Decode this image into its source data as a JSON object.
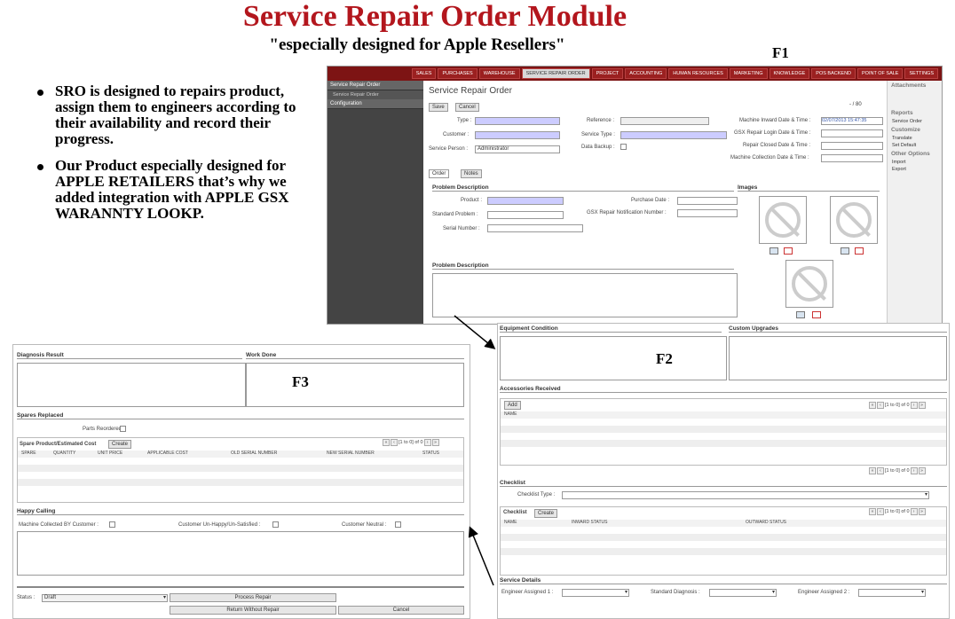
{
  "header": {
    "title": "Service Repair Order Module",
    "subtitle": "\"especially designed for Apple Resellers\"",
    "f1": "F1",
    "f2": "F2",
    "f3": "F3"
  },
  "bullets": [
    "SRO is designed to repairs product, assign them to engineers according to their availability and record their progress.",
    "Our Product especially designed for APPLE RETAILERS that’s why we added integration with APPLE GSX WARANNTY LOOKP."
  ],
  "topnav": [
    "SALES",
    "PURCHASES",
    "WAREHOUSE",
    "SERVICE REPAIR ORDER",
    "PROJECT",
    "ACCOUNTING",
    "HUMAN RESOURCES",
    "MARKETING",
    "KNOWLEDGE",
    "POS BACKEND",
    "POINT OF SALE",
    "SETTINGS"
  ],
  "leftnav": {
    "head": "Service Repair Order",
    "sub": "Service Repair Order",
    "config": "Configuration"
  },
  "form": {
    "title": "Service Repair Order",
    "save": "Save",
    "cancel": "Cancel",
    "pager": "- / 80",
    "type": "Type :",
    "customer": "Customer :",
    "service_person": "Service Person :",
    "service_person_val": "Administrator",
    "reference": "Reference :",
    "service_type": "Service Type :",
    "data_backup": "Data Backup :",
    "machine_inward": "Machine Inward Date & Time :",
    "machine_inward_val": "02/07/2013 15:47:35",
    "gsx_login": "GSX Repair Login Date & Time :",
    "repair_closed": "Repair Closed Date & Time :",
    "machine_collection": "Machine Collection Date & Time :",
    "tab_order": "Order",
    "tab_notes": "Notes",
    "problem_desc": "Problem Description",
    "images": "Images",
    "product": "Product :",
    "standard_problem": "Standard Problem :",
    "serial": "Serial Number :",
    "purchase_date": "Purchase Date :",
    "gsx_notif": "GSX Repair Notification Number :",
    "problem_desc2": "Problem Description"
  },
  "rightpanel": {
    "attachments": "Attachments",
    "reports": "Reports",
    "service_order": "Service Order",
    "customize": "Customize",
    "translate": "Translate",
    "set_default": "Set Default",
    "other": "Other Options",
    "import": "Import",
    "export": "Export"
  },
  "f2": {
    "equip": "Equipment Condition",
    "custom": "Custom Upgrades",
    "accessories": "Accessories Received",
    "add": "Add",
    "name": "NAME",
    "pager": "[1 to 0] of 0",
    "checklist": "Checklist",
    "checklist_type": "Checklist Type :",
    "checklist2": "Checklist",
    "create": "Create",
    "inward": "INWARD STATUS",
    "outward": "OUTWARD STATUS",
    "service_details": "Service Details",
    "eng1": "Engineer Assigned 1 :",
    "std_diag": "Standard Diagnosis :",
    "eng2": "Engineer Assigned 2 :"
  },
  "f3": {
    "diag": "Diagnosis Result",
    "work": "Work Done",
    "spares": "Spares Replaced",
    "parts_reordered": "Parts Reordered :",
    "spare_cost": "Spare Product/Estimated Cost",
    "create": "Create",
    "pager": "[1 to 0] of 0",
    "cols": [
      "SPARE",
      "QUANTITY",
      "UNIT PRICE",
      "APPLICABLE COST",
      "OLD SERIAL NUMBER",
      "NEW SERIAL NUMBER",
      "STATUS"
    ],
    "happy": "Happy Calling",
    "collected": "Machine Collected BY Customer :",
    "unhappy": "Customer Un-Happy/Un-Satisfied :",
    "neutral": "Customer Neutral :",
    "status": "Status :",
    "status_val": "Draft",
    "process": "Process Repair",
    "return": "Return Without Repair",
    "cancel": "Cancel"
  }
}
